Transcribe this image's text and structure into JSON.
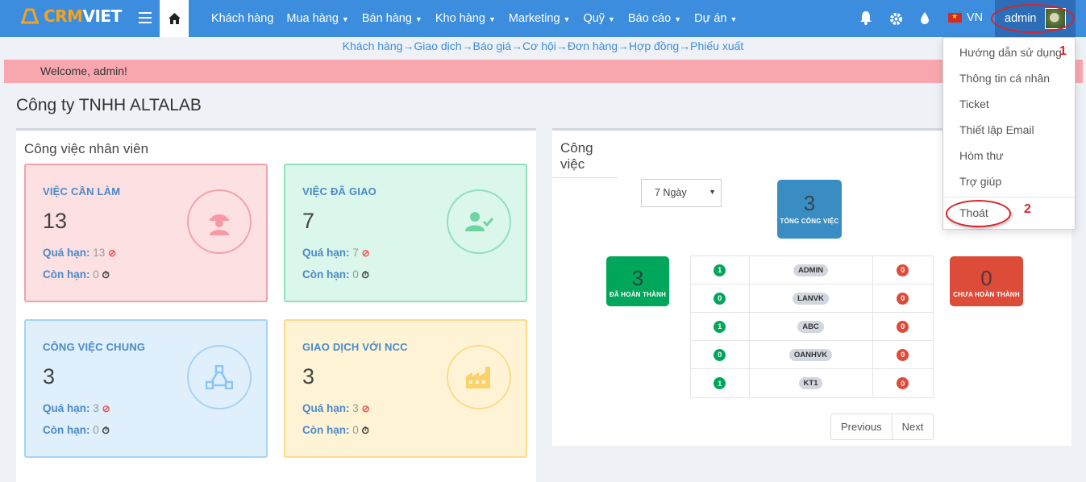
{
  "brand": {
    "part1": "CRM",
    "part2": "VIET"
  },
  "nav": {
    "menu": [
      {
        "label": "Khách hàng",
        "dropdown": false
      },
      {
        "label": "Mua hàng",
        "dropdown": true
      },
      {
        "label": "Bán hàng",
        "dropdown": true
      },
      {
        "label": "Kho hàng",
        "dropdown": true
      },
      {
        "label": "Marketing",
        "dropdown": true
      },
      {
        "label": "Quỹ",
        "dropdown": true
      },
      {
        "label": "Báo cáo",
        "dropdown": true
      },
      {
        "label": "Dự án",
        "dropdown": true
      }
    ],
    "language": "VN",
    "user": "admin"
  },
  "flow": [
    "Khách hàng",
    "Giao dịch",
    "Báo giá",
    "Cơ hội",
    "Đơn hàng",
    "Hợp đồng",
    "Phiếu xuất"
  ],
  "flow_separator": "→",
  "welcome": "Welcome, admin!",
  "company": "Công ty TNHH ALTALAB",
  "staff_panel": {
    "title": "Công việc nhân viên",
    "overdue_label": "Quá hạn:",
    "remaining_label": "Còn hạn:",
    "boxes": [
      {
        "label": "VIỆC CẦN LÀM",
        "value": "13",
        "overdue": "13",
        "remaining": "0",
        "icon": "worker-icon"
      },
      {
        "label": "VIỆC ĐÃ GIAO",
        "value": "7",
        "overdue": "7",
        "remaining": "0",
        "icon": "user-check-icon"
      },
      {
        "label": "CÔNG VIỆC CHUNG",
        "value": "3",
        "overdue": "3",
        "remaining": "0",
        "icon": "network-icon"
      },
      {
        "label": "GIAO DỊCH VỚI NCC",
        "value": "3",
        "overdue": "3",
        "remaining": "0",
        "icon": "factory-icon"
      }
    ]
  },
  "tasks_panel": {
    "title": "Công việc",
    "period": "7 Ngày",
    "total": {
      "value": "3",
      "label": "TỔNG CÔNG VIỆC"
    },
    "done": {
      "value": "3",
      "label": "ĐÃ HOÀN THÀNH"
    },
    "undone": {
      "value": "0",
      "label": "CHƯA HOÀN THÀNH"
    },
    "rows": [
      {
        "done": "1",
        "name": "ADMIN",
        "undone": "0"
      },
      {
        "done": "0",
        "name": "LANVK",
        "undone": "0"
      },
      {
        "done": "1",
        "name": "ABC",
        "undone": "0"
      },
      {
        "done": "0",
        "name": "OANHVK",
        "undone": "0"
      },
      {
        "done": "1",
        "name": "KT1",
        "undone": "0"
      }
    ],
    "prev": "Previous",
    "next": "Next"
  },
  "user_menu": {
    "items": [
      "Hướng dẫn sử dụng",
      "Thông tin cá nhân",
      "Ticket",
      "Thiết lập Email",
      "Hòm thư",
      "Trợ giúp"
    ],
    "logout": "Thoát",
    "annotation_1": "1",
    "annotation_2": "2"
  },
  "colors": {
    "nav": "#3c8dde",
    "accent": "#f7a21b",
    "annotation": "#d9242a"
  }
}
